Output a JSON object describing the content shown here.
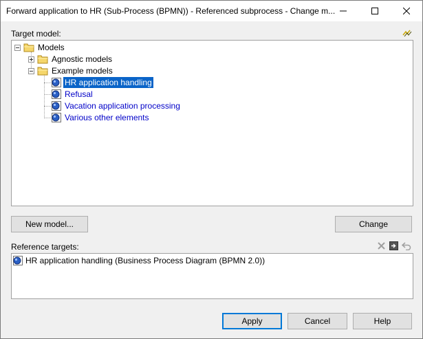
{
  "window": {
    "title": "Forward application to HR (Sub-Process (BPMN)) - Referenced subprocess - Change m..."
  },
  "target_model": {
    "label": "Target model:",
    "tree": {
      "root": "Models",
      "agnostic": "Agnostic models",
      "example": "Example models",
      "items": [
        "HR application handling",
        "Refusal",
        "Vacation application processing",
        "Various other elements"
      ],
      "selected": "HR application handling"
    }
  },
  "buttons": {
    "new_model": "New model...",
    "change": "Change",
    "apply": "Apply",
    "cancel": "Cancel",
    "help": "Help"
  },
  "reference_targets": {
    "label": "Reference targets:",
    "items": [
      "HR application handling (Business Process Diagram (BPMN 2.0))"
    ]
  },
  "colors": {
    "selection": "#0a64c8",
    "link_text": "#0000c8",
    "default_button_border": "#0078d7"
  },
  "icons": [
    "minimize-icon",
    "maximize-icon",
    "close-icon",
    "filter-icon",
    "folder-icon",
    "bpmn-model-icon",
    "delete-icon",
    "navigate-icon",
    "undo-icon"
  ]
}
